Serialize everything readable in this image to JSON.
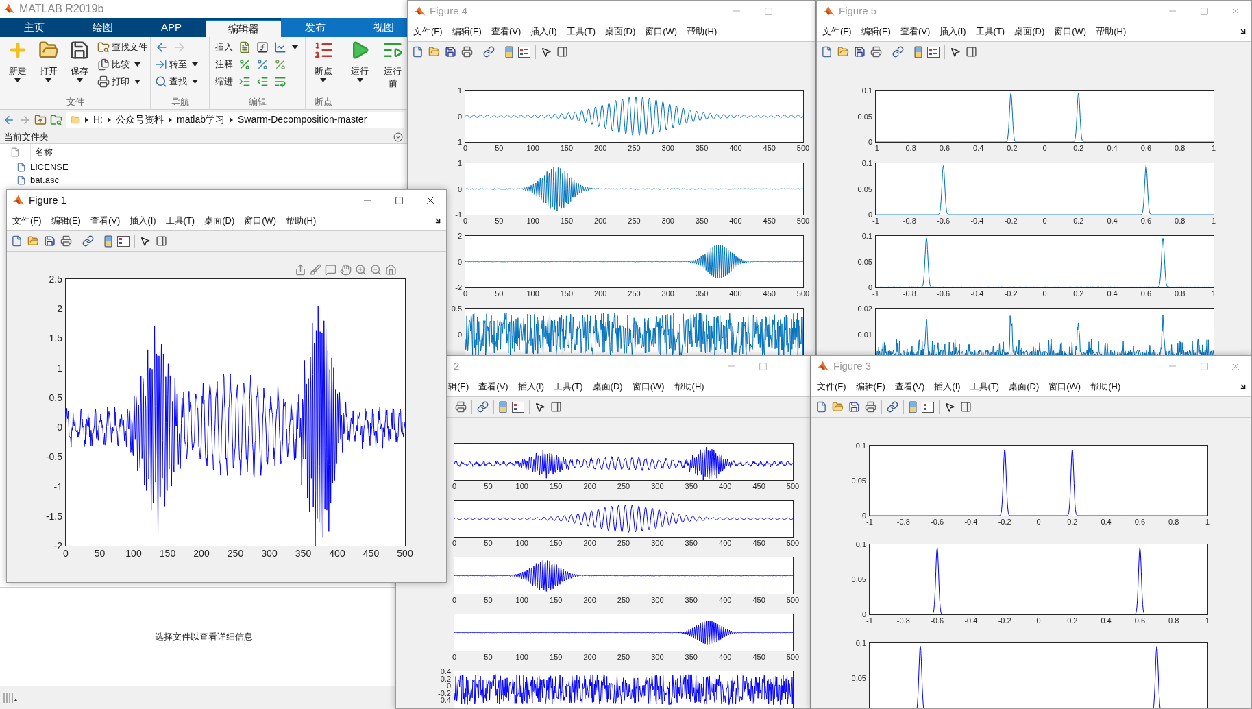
{
  "windows": [
    {
      "kind": "main",
      "title": "MATLAB R2019b",
      "tabs": [
        {
          "label": "主页",
          "selected": false,
          "contextual": false
        },
        {
          "label": "绘图",
          "selected": false,
          "contextual": false
        },
        {
          "label": "APP",
          "selected": false,
          "contextual": false
        },
        {
          "label": "编辑器",
          "selected": true,
          "contextual": true
        },
        {
          "label": "发布",
          "selected": false,
          "contextual": true
        },
        {
          "label": "视图",
          "selected": false,
          "contextual": true
        }
      ],
      "ribbon": [
        {
          "label": "文件",
          "columns": [
            {
              "kind": "large",
              "label": "新建",
              "caret": true
            },
            {
              "kind": "large",
              "label": "打开",
              "caret": true
            },
            {
              "kind": "large",
              "label": "保存",
              "caret": true
            },
            {
              "kind": "stack",
              "items": [
                {
                  "label": "查找文件",
                  "caret": false
                },
                {
                  "label": "比较",
                  "caret": true
                },
                {
                  "label": "打印",
                  "caret": true
                }
              ]
            }
          ]
        },
        {
          "label": "导航",
          "columns": [
            {
              "kind": "stack",
              "items": [
                {
                  "caret": false,
                  "forward_disabled": true
                },
                {
                  "label": "转至",
                  "caret": true
                },
                {
                  "label": "查找",
                  "caret": true
                }
              ]
            }
          ]
        },
        {
          "label": "编辑",
          "columns": [
            {
              "kind": "tools",
              "items": [
                {
                  "label": "插入",
                  "caret": true
                },
                {
                  "label": "注释",
                  "caret": false
                },
                {
                  "label": "缩进",
                  "caret": false
                }
              ]
            }
          ]
        },
        {
          "label": "断点",
          "columns": [
            {
              "kind": "large",
              "label": "断点",
              "caret": true
            }
          ]
        },
        {
          "columns": [
            {
              "kind": "large",
              "label": "运行",
              "caret": true
            },
            {
              "kind": "large",
              "label": "运行",
              "sublabel": "前",
              "caret": false
            }
          ]
        }
      ],
      "address": {
        "forward_disabled": true,
        "path": [
          "H:",
          "公众号资料",
          "matlab学习",
          "Swarm-Decomposition-master"
        ]
      },
      "panel_title": "当前文件夹",
      "column": "名称",
      "files": [
        "LICENSE",
        "bat.asc"
      ],
      "details": "选择文件以查看详细信息"
    },
    {
      "kind": "figure",
      "title": "Figure 4",
      "active": false,
      "partly_hidden": false,
      "close_button": false,
      "dock_arrow": false,
      "axes_toolbar": false,
      "color": "#0072bd",
      "menu": [
        "文件(F)",
        "编辑(E)",
        "查看(V)",
        "插入(I)",
        "工具(T)",
        "桌面(D)",
        "窗口(W)",
        "帮助(H)"
      ],
      "plots": [
        {
          "kind": "carrier",
          "yticks": [
            "1",
            "0",
            "-1"
          ],
          "xticks": [
            "0",
            "50",
            "100",
            "150",
            "200",
            "250",
            "300",
            "350",
            "400",
            "450",
            "500"
          ]
        },
        {
          "kind": "early-burst",
          "yticks": [
            "1",
            "0",
            "-1"
          ],
          "xticks": [
            "0",
            "50",
            "100",
            "150",
            "200",
            "250",
            "300",
            "350",
            "400",
            "450",
            "500"
          ]
        },
        {
          "kind": "late-burst",
          "yticks": [
            "2",
            "0",
            "-2"
          ],
          "xticks": [
            "0",
            "50",
            "100",
            "150",
            "200",
            "250",
            "300",
            "350",
            "400",
            "450",
            "500"
          ]
        },
        {
          "kind": "noise",
          "yticks": [
            "0.5",
            "0"
          ]
        }
      ]
    },
    {
      "kind": "figure",
      "title": "Figure 5",
      "active": false,
      "partly_hidden": false,
      "close_button": true,
      "dock_arrow": true,
      "axes_toolbar": false,
      "color": "#0072bd",
      "menu": [
        "文件(F)",
        "编辑(E)",
        "查看(V)",
        "插入(I)",
        "工具(T)",
        "桌面(D)",
        "窗口(W)",
        "帮助(H)"
      ],
      "plots": [
        {
          "kind": "inner-peaks",
          "yticks": [
            "0.1",
            "0.05",
            "0"
          ],
          "xticks": [
            "-1",
            "-0.8",
            "-0.6",
            "-0.4",
            "-0.2",
            "0",
            "0.2",
            "0.4",
            "0.6",
            "0.8",
            "1"
          ]
        },
        {
          "kind": "middle-peaks",
          "yticks": [
            "0.1",
            "0.05",
            "0"
          ],
          "xticks": [
            "-1",
            "-0.8",
            "-0.6",
            "-0.4",
            "-0.2",
            "0",
            "0.2",
            "0.4",
            "0.6",
            "0.8",
            "1"
          ]
        },
        {
          "kind": "outer-peaks",
          "yticks": [
            "0.1",
            "0.05",
            "0"
          ],
          "xticks": [
            "-1",
            "-0.8",
            "-0.6",
            "-0.4",
            "-0.2",
            "0",
            "0.2",
            "0.4",
            "0.6",
            "0.8",
            "1"
          ]
        },
        {
          "kind": "noise-spectrum",
          "yticks": [
            "0.02",
            "0.01"
          ]
        }
      ]
    },
    {
      "kind": "figure",
      "title": "2",
      "active": false,
      "partly_hidden": true,
      "close_button": false,
      "dock_arrow": false,
      "axes_toolbar": false,
      "color": "#0000ff",
      "menu": [
        "辑(E)",
        "查看(V)",
        "插入(I)",
        "工具(T)",
        "桌面(D)",
        "窗口(W)",
        "帮助(H)"
      ],
      "plots": [
        {
          "kind": "sum",
          "xticks": [
            "0",
            "50",
            "100",
            "150",
            "200",
            "250",
            "300",
            "350",
            "400",
            "450",
            "500"
          ]
        },
        {
          "kind": "carrier",
          "xticks": [
            "0",
            "50",
            "100",
            "150",
            "200",
            "250",
            "300",
            "350",
            "400",
            "450",
            "500"
          ]
        },
        {
          "kind": "early-burst",
          "xticks": [
            "0",
            "50",
            "100",
            "150",
            "200",
            "250",
            "300",
            "350",
            "400",
            "450",
            "500"
          ]
        },
        {
          "kind": "late-burst",
          "xticks": [
            "0",
            "50",
            "100",
            "150",
            "200",
            "250",
            "300",
            "350",
            "400",
            "450",
            "500"
          ]
        },
        {
          "kind": "noise",
          "yticks": [
            "0.4",
            "0.2",
            "0",
            "-0.2",
            "-0.4"
          ]
        }
      ]
    },
    {
      "kind": "figure",
      "title": "Figure 3",
      "active": false,
      "partly_hidden": false,
      "close_button": true,
      "dock_arrow": true,
      "axes_toolbar": false,
      "color": "#0000ff",
      "menu": [
        "文件(F)",
        "编辑(E)",
        "查看(V)",
        "插入(I)",
        "工具(T)",
        "桌面(D)",
        "窗口(W)",
        "帮助(H)"
      ],
      "plots": [
        {
          "kind": "inner-peaks",
          "yticks": [
            "0.1",
            "0.05",
            "0"
          ],
          "xticks": [
            "-1",
            "-0.8",
            "-0.6",
            "-0.4",
            "-0.2",
            "0",
            "0.2",
            "0.4",
            "0.6",
            "0.8",
            "1"
          ]
        },
        {
          "kind": "middle-peaks",
          "yticks": [
            "0.1",
            "0.05",
            "0"
          ],
          "xticks": [
            "-1",
            "-0.8",
            "-0.6",
            "-0.4",
            "-0.2",
            "0",
            "0.2",
            "0.4",
            "0.6",
            "0.8",
            "1"
          ]
        },
        {
          "kind": "outer-peaks",
          "yticks": [
            "0.1",
            "0.05"
          ]
        }
      ]
    },
    {
      "kind": "figure",
      "title": "Figure 1",
      "active": true,
      "partly_hidden": false,
      "close_button": true,
      "dock_arrow": true,
      "axes_toolbar": true,
      "color": "#0000ff",
      "menu": [
        "文件(F)",
        "编辑(E)",
        "查看(V)",
        "插入(I)",
        "工具(T)",
        "桌面(D)",
        "窗口(W)",
        "帮助(H)"
      ],
      "plots": [
        {
          "kind": "sum",
          "yticks": [
            "2.5",
            "2",
            "1.5",
            "1",
            "0.5",
            "0",
            "-0.5",
            "-1",
            "-1.5",
            "-2"
          ],
          "xticks": [
            "0",
            "50",
            "100",
            "150",
            "200",
            "250",
            "300",
            "350",
            "400",
            "450",
            "500"
          ]
        }
      ]
    }
  ]
}
